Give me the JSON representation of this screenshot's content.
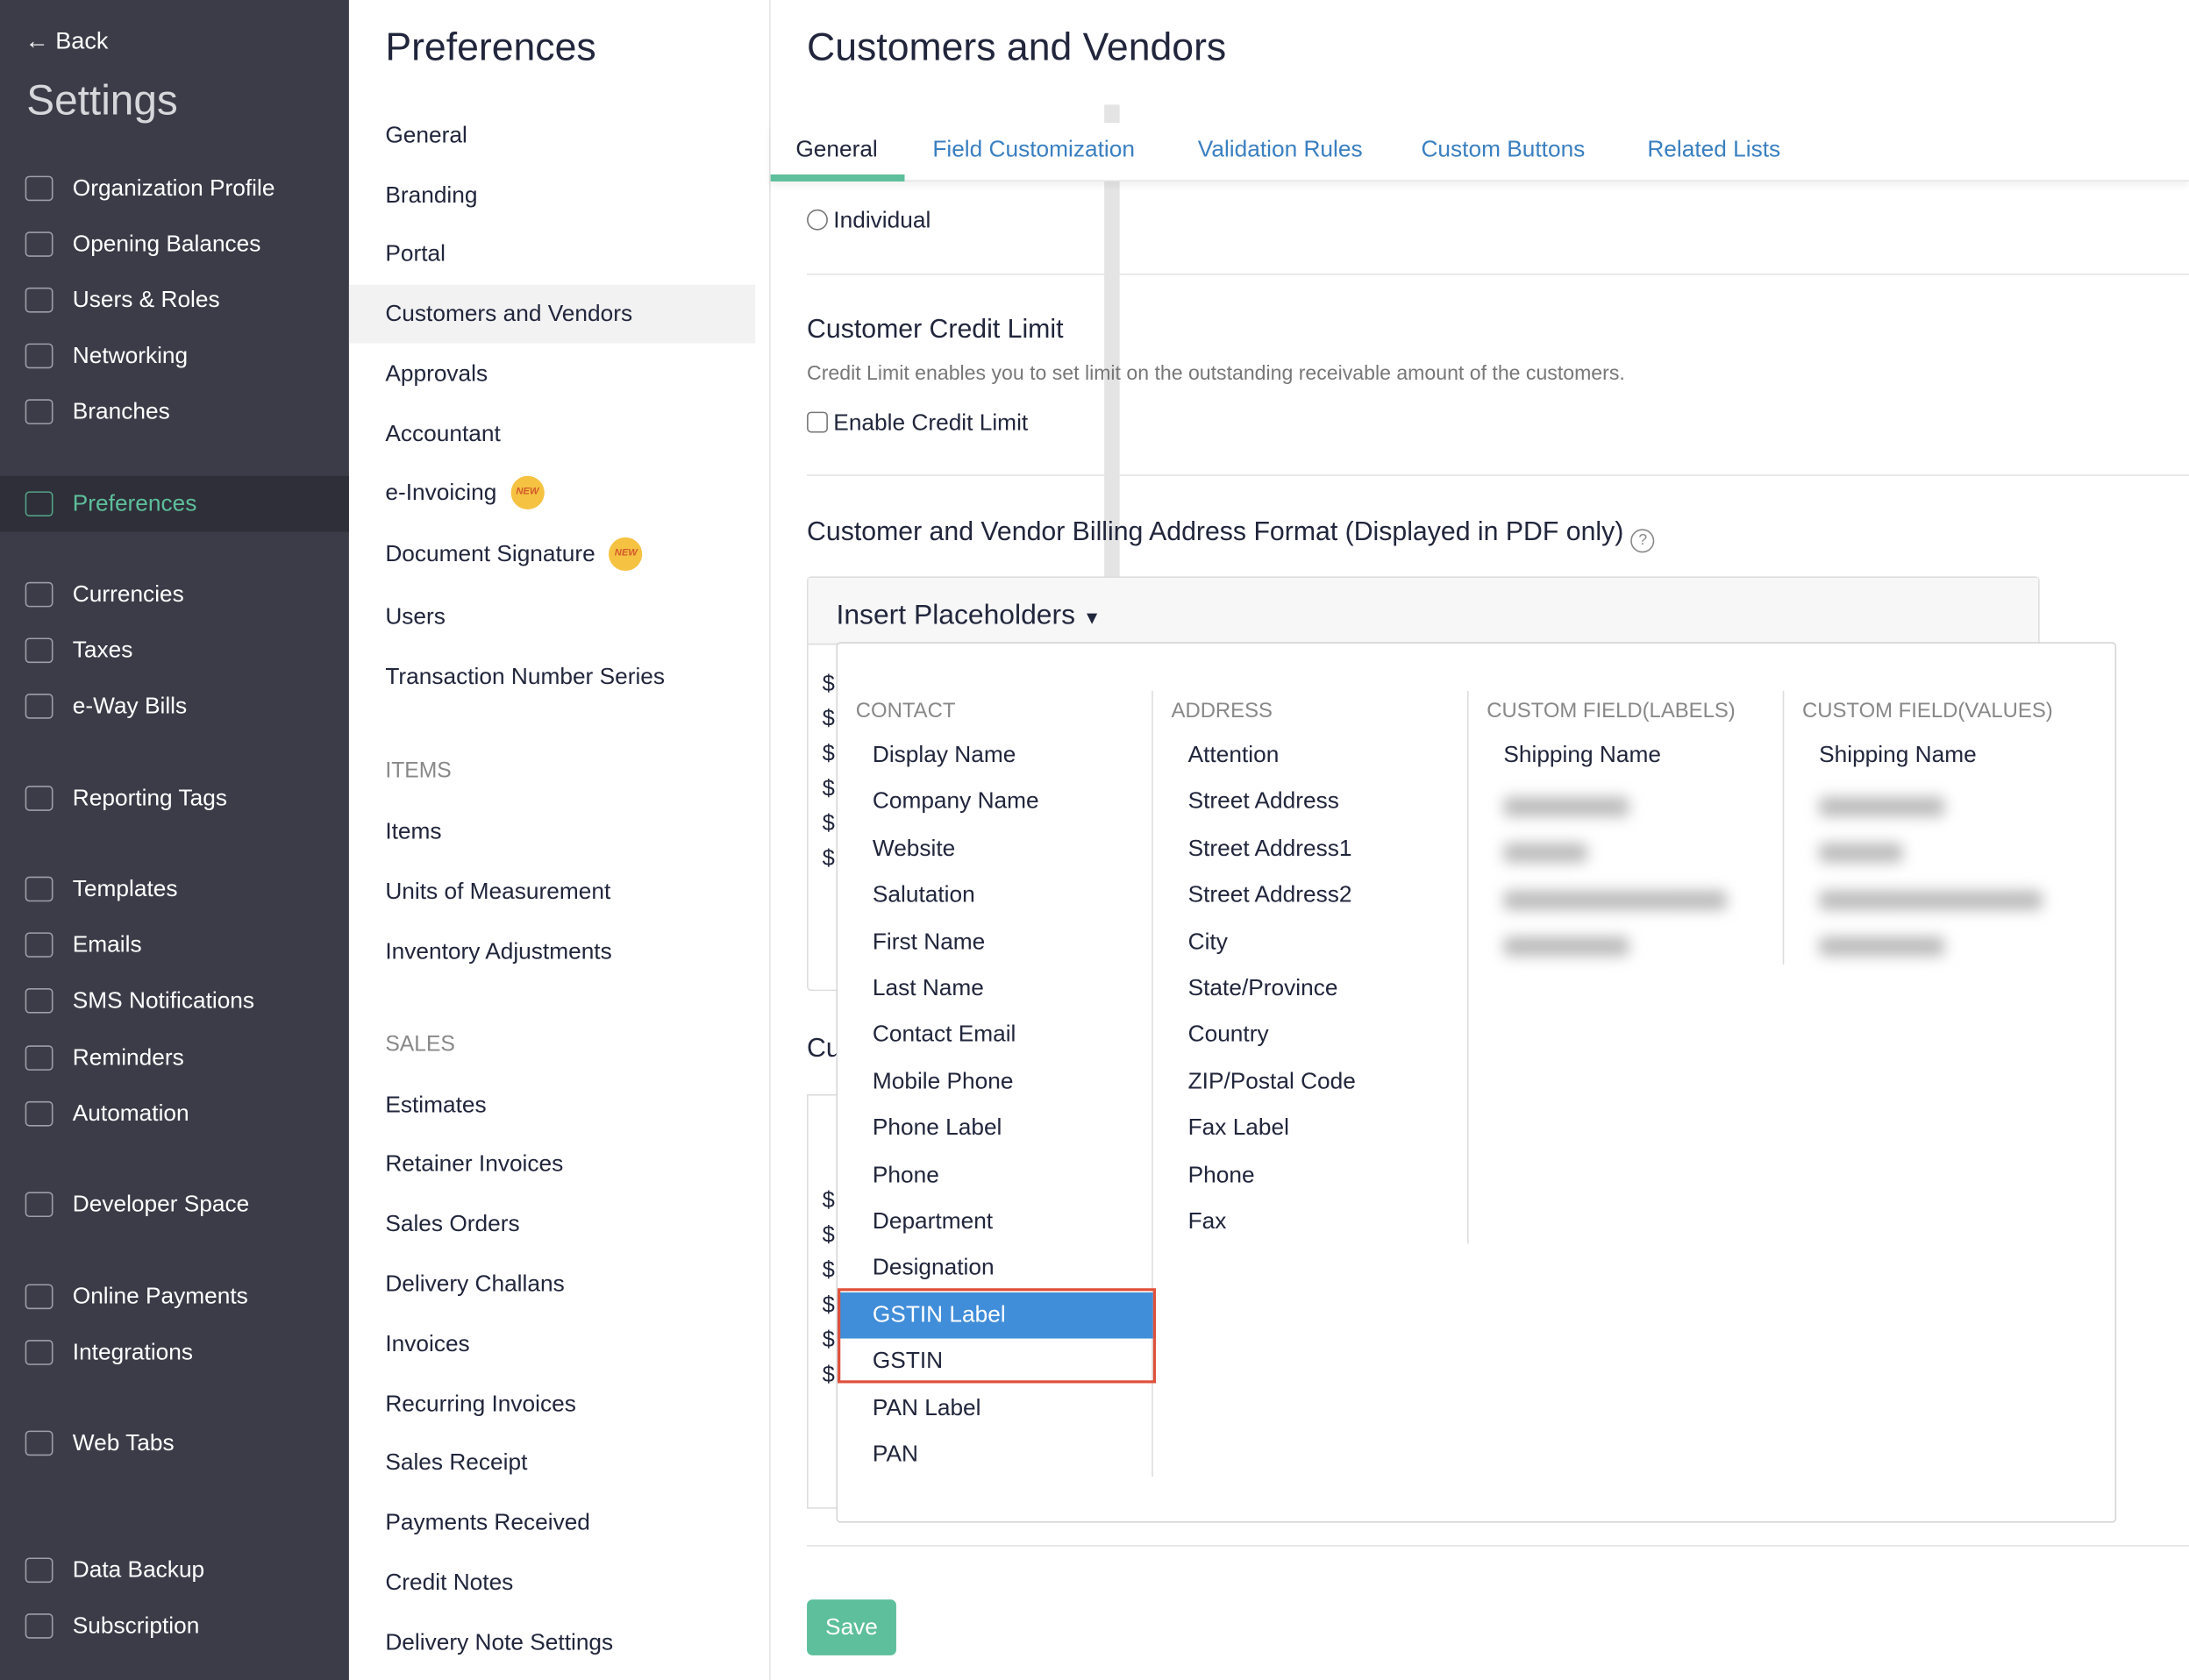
{
  "sidebar": {
    "back": "Back",
    "title": "Settings",
    "items": [
      {
        "label": "Organization Profile",
        "icon": "building-icon"
      },
      {
        "label": "Opening Balances",
        "icon": "receipt-icon"
      },
      {
        "label": "Users & Roles",
        "icon": "users-icon"
      },
      {
        "label": "Networking",
        "icon": "rings-icon"
      },
      {
        "label": "Branches",
        "icon": "branch-icon"
      },
      {
        "label": "Preferences",
        "icon": "sliders-icon",
        "active": true
      },
      {
        "label": "Currencies",
        "icon": "currency-icon"
      },
      {
        "label": "Taxes",
        "icon": "percent-icon"
      },
      {
        "label": "e-Way Bills",
        "icon": "eway-icon"
      },
      {
        "label": "Reporting Tags",
        "icon": "tag-icon"
      },
      {
        "label": "Templates",
        "icon": "palette-icon"
      },
      {
        "label": "Emails",
        "icon": "mail-icon"
      },
      {
        "label": "SMS Notifications",
        "icon": "sms-icon"
      },
      {
        "label": "Reminders",
        "icon": "bell-icon"
      },
      {
        "label": "Automation",
        "icon": "refresh-icon"
      },
      {
        "label": "Developer Space",
        "icon": "code-icon"
      },
      {
        "label": "Online Payments",
        "icon": "payment-icon"
      },
      {
        "label": "Integrations",
        "icon": "plug-icon"
      },
      {
        "label": "Web Tabs",
        "icon": "window-icon"
      },
      {
        "label": "Data Backup",
        "icon": "backup-icon"
      },
      {
        "label": "Subscription",
        "icon": "subscription-icon"
      }
    ]
  },
  "prefs": {
    "title": "Preferences",
    "items": [
      "General",
      "Branding",
      "Portal",
      "Customers and Vendors",
      "Approvals",
      "Accountant",
      "e-Invoicing",
      "Document Signature",
      "Users",
      "Transaction Number Series"
    ],
    "badge": "NEW",
    "items_header": "ITEMS",
    "items_section": [
      "Items",
      "Units of Measurement",
      "Inventory Adjustments"
    ],
    "sales_header": "SALES",
    "sales_section": [
      "Estimates",
      "Retainer Invoices",
      "Sales Orders",
      "Delivery Challans",
      "Invoices",
      "Recurring Invoices",
      "Sales Receipt",
      "Payments Received",
      "Credit Notes",
      "Delivery Note Settings"
    ]
  },
  "main": {
    "title": "Customers and Vendors",
    "tabs": [
      "General",
      "Field Customization",
      "Validation Rules",
      "Custom Buttons",
      "Related Lists"
    ],
    "radio_individual": "Individual",
    "credit_title": "Customer Credit Limit",
    "credit_desc": "Credit Limit enables you to set limit on the outstanding receivable amount of the customers.",
    "credit_checkbox": "Enable Credit Limit",
    "address_title": "Customer and Vendor Billing Address Format (Displayed in PDF only)",
    "insert_placeholders": "Insert Placeholders",
    "cut_heading": "Cu",
    "dollar": "$",
    "save": "Save"
  },
  "dropdown": {
    "columns": [
      {
        "header": "CONTACT",
        "items": [
          "Display Name",
          "Company Name",
          "Website",
          "Salutation",
          "First Name",
          "Last Name",
          "Contact Email",
          "Mobile Phone",
          "Phone Label",
          "Phone",
          "Department",
          "Designation",
          "GSTIN Label",
          "GSTIN",
          "PAN Label",
          "PAN"
        ],
        "selected": "GSTIN Label"
      },
      {
        "header": "ADDRESS",
        "items": [
          "Attention",
          "Street Address",
          "Street Address1",
          "Street Address2",
          "City",
          "State/Province",
          "Country",
          "ZIP/Postal Code",
          "Fax Label",
          "Phone",
          "Fax"
        ]
      },
      {
        "header": "CUSTOM FIELD(LABELS)",
        "items": [
          "Shipping Name"
        ]
      },
      {
        "header": "CUSTOM FIELD(VALUES)",
        "items": [
          "Shipping Name"
        ]
      }
    ]
  },
  "colors": {
    "sidebar": "#3b3c47",
    "accent": "#5dbf9b",
    "link": "#3a7fc1",
    "selected": "#408dd9",
    "highlight": "#e0503a"
  }
}
